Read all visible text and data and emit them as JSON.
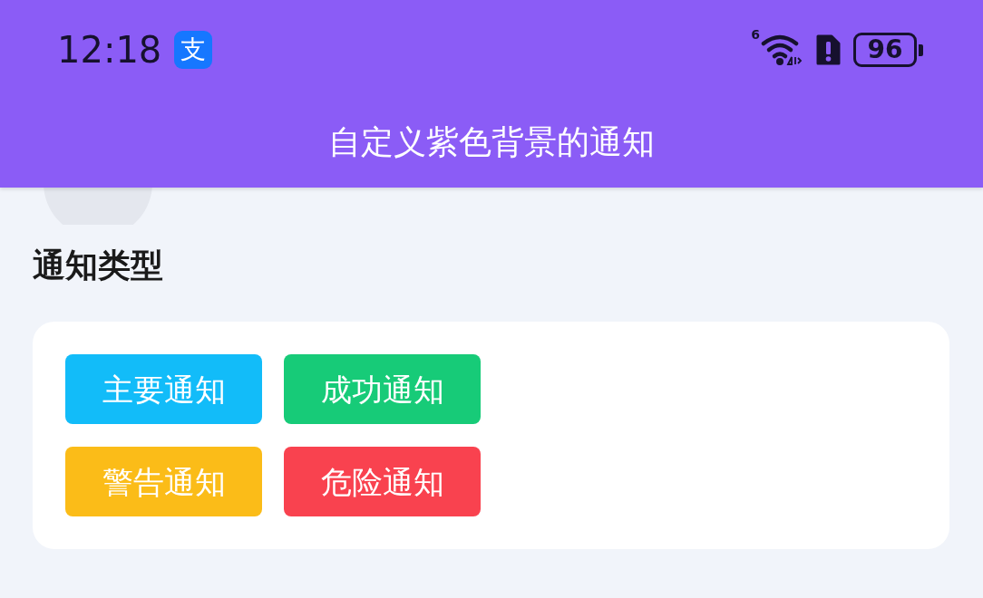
{
  "status_bar": {
    "time": "12:18",
    "app_icon": "支",
    "wifi_label": "6",
    "battery": "96"
  },
  "notification": {
    "text": "自定义紫色背景的通知"
  },
  "section": {
    "title": "通知类型",
    "buttons": [
      {
        "label": "主要通知",
        "color": "#12bcf9"
      },
      {
        "label": "成功通知",
        "color": "#17cb78"
      },
      {
        "label": "警告通知",
        "color": "#fbbc18"
      },
      {
        "label": "危险通知",
        "color": "#f9424f"
      }
    ]
  }
}
